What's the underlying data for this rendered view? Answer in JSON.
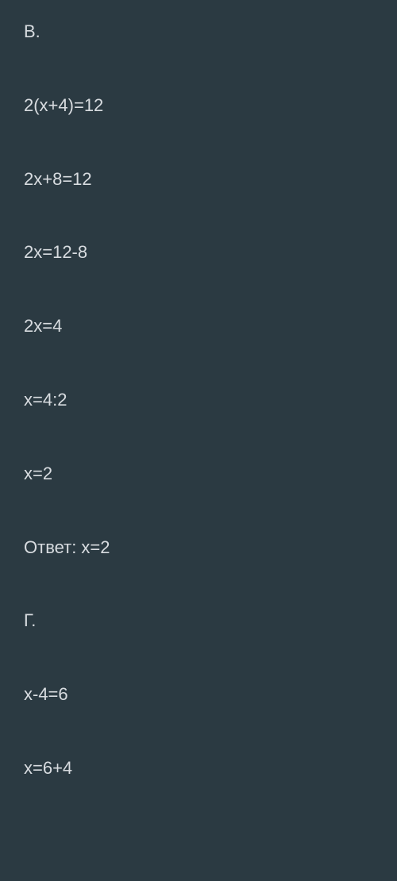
{
  "lines": [
    "В.",
    "2(x+4)=12",
    "2x+8=12",
    "2x=12-8",
    "2x=4",
    "x=4:2",
    "x=2",
    "Ответ: x=2",
    "Г.",
    "x-4=6",
    "x=6+4"
  ]
}
